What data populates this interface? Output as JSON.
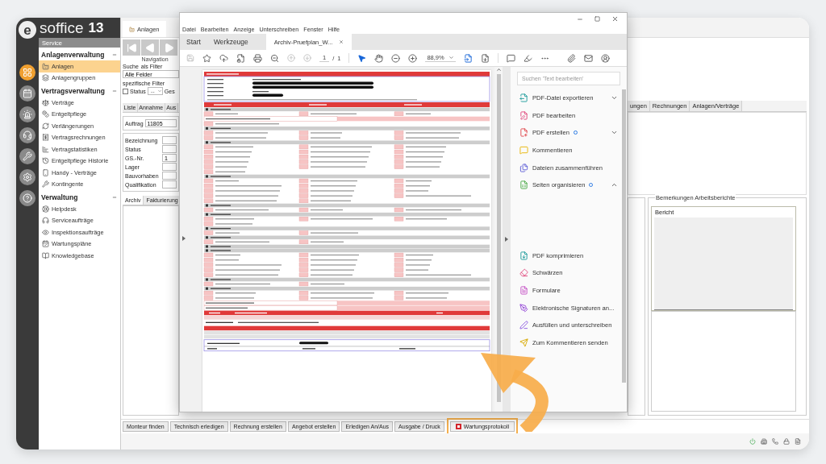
{
  "launcher": {
    "logo_letter": "e",
    "title": "soffice",
    "version": "13"
  },
  "sidebar": {
    "header": "Service",
    "sections": [
      {
        "title": "Anlagenverwaltung",
        "expanded": true,
        "items": [
          {
            "label": "Anlagen",
            "selected": true
          },
          {
            "label": "Anlagengruppen",
            "selected": false
          }
        ]
      },
      {
        "title": "Vertragsverwaltung",
        "expanded": true,
        "items": [
          {
            "label": "Verträge",
            "selected": false
          },
          {
            "label": "Entgeltpflege",
            "selected": false
          },
          {
            "label": "Verlängerungen",
            "selected": false
          },
          {
            "label": "Vertragsrechnungen",
            "selected": false
          },
          {
            "label": "Vertragstatistiken",
            "selected": false
          },
          {
            "label": "Entgeltpflege Historie",
            "selected": false
          },
          {
            "label": "Handy - Verträge",
            "selected": false
          },
          {
            "label": "Kontingente",
            "selected": false
          }
        ]
      },
      {
        "title": "Verwaltung",
        "expanded": true,
        "items": [
          {
            "label": "Helpdesk",
            "selected": false
          },
          {
            "label": "Serviceaufträge",
            "selected": false
          },
          {
            "label": "Inspektionsaufträge",
            "selected": false
          },
          {
            "label": "Wartungspläne",
            "selected": false
          },
          {
            "label": "Knowledgebase",
            "selected": false
          }
        ]
      }
    ]
  },
  "main": {
    "tab": "Anlagen",
    "navigation_label": "Navigation",
    "search": {
      "label": "Suche",
      "mode": "als Filter",
      "value": "Alle Felder"
    },
    "filter_title": "spezifische Filter",
    "status_filter": {
      "label": "Status",
      "checked": false,
      "value": "--",
      "next": "Ges"
    },
    "tabs": [
      {
        "label": "Liste",
        "selected": false
      },
      {
        "label": "Annahme",
        "selected": false
      },
      {
        "label": "Aus",
        "selected": false
      }
    ],
    "order": {
      "label": "Auftrag",
      "value": "11805"
    },
    "fields": [
      {
        "label": "Bezeichnung"
      },
      {
        "label": "Status"
      },
      {
        "label": "GS.-Nr.",
        "value": "1"
      },
      {
        "label": "Lager"
      },
      {
        "label": "Bauvorhaben"
      },
      {
        "label": "Qualifikation"
      }
    ],
    "bottom_tabs": [
      {
        "label": "Archiv",
        "selected": true
      },
      {
        "label": "Fakturierung",
        "selected": false
      }
    ],
    "right_tabs": [
      {
        "label": "ungen",
        "selected": false
      },
      {
        "label": "Rechnungen",
        "selected": false
      },
      {
        "label": "Anlagen/Verträge",
        "selected": false
      }
    ],
    "remarks": {
      "title": "Bemerkungen Arbeitsberichte",
      "column": "Bericht"
    }
  },
  "actions": [
    {
      "label": "Monteur finden",
      "highlighted": false,
      "kind": "plain"
    },
    {
      "label": "Technisch erledigen",
      "highlighted": false,
      "kind": "plain"
    },
    {
      "label": "Rechnung erstellen",
      "highlighted": false,
      "kind": "plain"
    },
    {
      "label": "Angebot erstellen",
      "highlighted": false,
      "kind": "plain"
    },
    {
      "label": "Erledigen An/Aus",
      "highlighted": false,
      "kind": "plain"
    },
    {
      "label": "Ausgabe / Druck",
      "highlighted": false,
      "kind": "plain"
    },
    {
      "label": "Wartungsprotokoll",
      "highlighted": true,
      "kind": "report"
    }
  ],
  "pdf_viewer": {
    "menu": [
      "Datei",
      "Bearbeiten",
      "Anzeige",
      "Unterschreiben",
      "Fenster",
      "Hilfe"
    ],
    "tabs": [
      {
        "label": "Start",
        "selected": false
      },
      {
        "label": "Werkzeuge",
        "selected": false
      },
      {
        "label": "Archiv-Pruefplan_W...",
        "selected": true
      }
    ],
    "page": {
      "current": "1",
      "separator": "/",
      "total": "1"
    },
    "zoom": "88,9%",
    "tools_panel": {
      "search_placeholder": "Suchen 'Text bearbeiten'",
      "tools": [
        {
          "label": "PDF-Datei exportieren",
          "kind": "export",
          "badge": false,
          "expanded": false
        },
        {
          "label": "PDF bearbeiten",
          "kind": "edit",
          "badge": false
        },
        {
          "label": "PDF erstellen",
          "kind": "create",
          "badge": true,
          "expanded": false
        },
        {
          "label": "Kommentieren",
          "kind": "comment",
          "badge": false
        },
        {
          "label": "Dateien zusammenführen",
          "kind": "combine",
          "badge": false
        },
        {
          "label": "Seiten organisieren",
          "kind": "organize",
          "badge": true,
          "expanded": true
        }
      ],
      "more_tools": [
        {
          "label": "PDF komprimieren",
          "kind": "compress",
          "badge": false
        },
        {
          "label": "Schwärzen",
          "kind": "redact",
          "badge": false
        },
        {
          "label": "Formulare",
          "kind": "forms",
          "badge": false
        },
        {
          "label": "Elektronische Signaturen an...",
          "kind": "sign",
          "badge": false
        },
        {
          "label": "Ausfüllen und unterschreiben",
          "kind": "fill",
          "badge": false
        },
        {
          "label": "Zum Kommentieren senden",
          "kind": "send",
          "badge": false
        }
      ]
    }
  }
}
